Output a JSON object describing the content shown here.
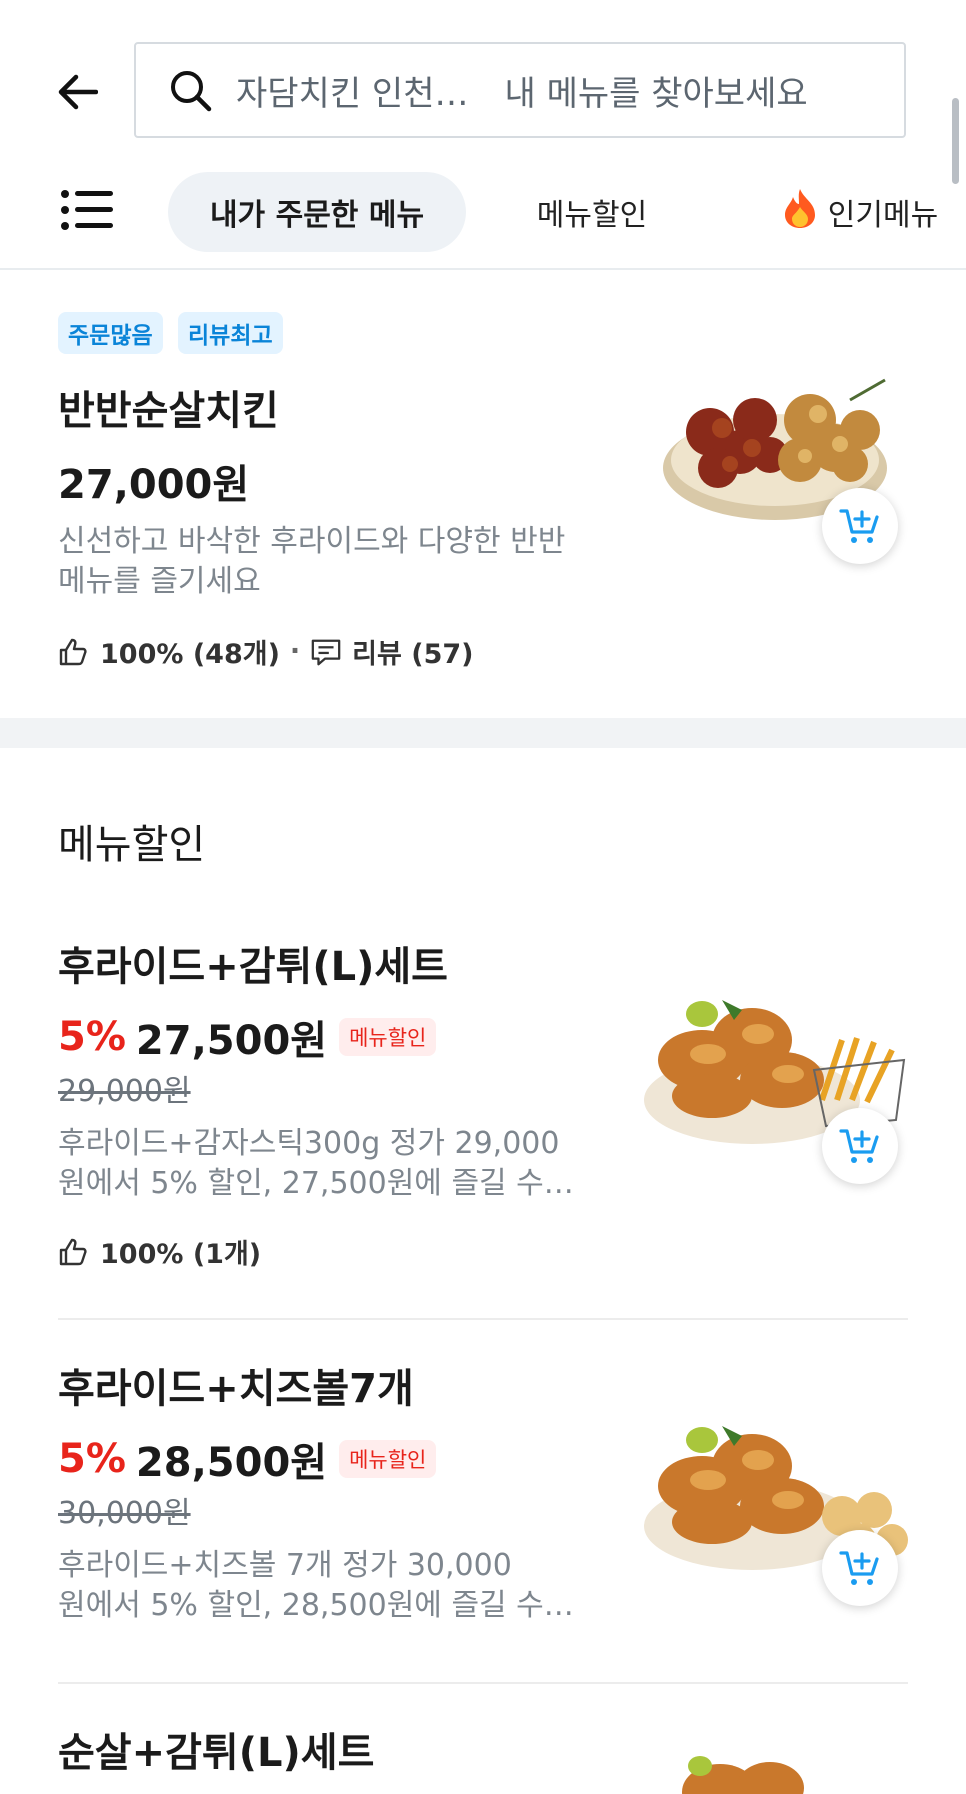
{
  "header": {
    "shop_name": "자담치킨 인천…",
    "search_placeholder": "내 메뉴를 찾아보세요"
  },
  "tabs": [
    {
      "label": "내가 주문한 메뉴",
      "active": true
    },
    {
      "label": "메뉴할인",
      "active": false
    },
    {
      "label": "인기메뉴",
      "active": false,
      "icon": "flame-icon"
    }
  ],
  "featured": {
    "badges": [
      "주문많음",
      "리뷰최고"
    ],
    "name": "반반순살치킨",
    "price": "27,000원",
    "desc_line1": "신선하고 바삭한 후라이드와 다양한 반반",
    "desc_line2": "메뉴를 즐기세요",
    "likes": "100% (48개)",
    "separator": "·",
    "reviews": "리뷰 (57)"
  },
  "discount_section": {
    "title": "메뉴할인",
    "tag_label": "메뉴할인",
    "items": [
      {
        "name": "후라이드+감튀(L)세트",
        "discount": "5%",
        "price": "27,500원",
        "original_price": "29,000원",
        "desc_line1": "후라이드+감자스틱300g 정가 29,000",
        "desc_line2": "원에서 5% 할인, 27,500원에 즐길 수…",
        "likes": "100% (1개)"
      },
      {
        "name": "후라이드+치즈볼7개",
        "discount": "5%",
        "price": "28,500원",
        "original_price": "30,000원",
        "desc_line1": "후라이드+치즈볼 7개 정가 30,000",
        "desc_line2": "원에서 5% 할인, 28,500원에 즐길 수…"
      },
      {
        "name": "순살+감튀(L)세트"
      }
    ]
  },
  "colors": {
    "accent_blue": "#0a84d8",
    "discount_red": "#e8241b",
    "tab_active_bg": "#eef2f6"
  }
}
